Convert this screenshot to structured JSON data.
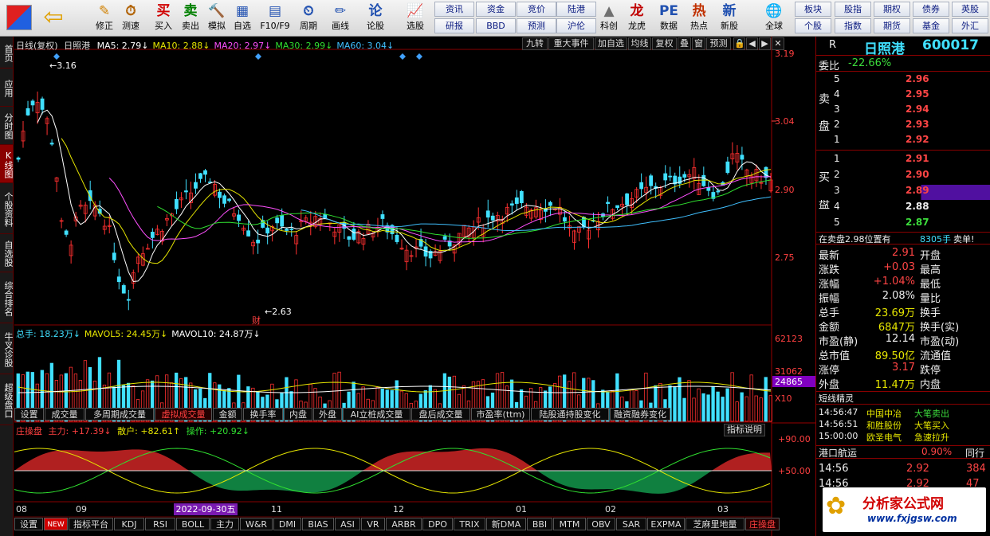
{
  "toolbar": {
    "buttons": [
      "修正",
      "测速",
      "买入",
      "卖出",
      "模拟",
      "自选",
      "F10/F9",
      "周期",
      "画线",
      "论股",
      "选股",
      "科创",
      "龙虎",
      "数据",
      "热点",
      "新股",
      "全球"
    ],
    "grid": [
      "资讯",
      "资金",
      "竞价",
      "陆港",
      "研报",
      "BBD",
      "预测",
      "沪伦",
      "板块",
      "股指",
      "期权",
      "债券",
      "英股",
      "个股",
      "指数",
      "期货",
      "基金",
      "外汇"
    ]
  },
  "leftnav": [
    "首页",
    "应用",
    "分时图",
    "K线图",
    "个股资料",
    "自选股",
    "综合排名",
    "牛叉诊股",
    "超级盘口"
  ],
  "chart": {
    "title": "日线(复权)",
    "stock": "日照港",
    "ma": [
      {
        "label": "MA5: 2.79↓",
        "color": "#ffffff"
      },
      {
        "label": "MA10: 2.88↓",
        "color": "#e6e600"
      },
      {
        "label": "MA20: 2.97↓",
        "color": "#ff50ff"
      },
      {
        "label": "MA30: 2.99↓",
        "color": "#30e030"
      },
      {
        "label": "MA60: 3.04↓",
        "color": "#40c0ff"
      }
    ],
    "buttons": [
      "九转",
      "重大事件",
      "加自选",
      "均线",
      "复权",
      "叠",
      "窗",
      "预测",
      "🔒",
      "◀",
      "▶",
      "✕"
    ],
    "hi": "3.16",
    "lo": "2.63",
    "cai": "财",
    "vol": [
      {
        "label": "总手: 18.23万↓",
        "color": "#40e0ff"
      },
      {
        "label": "MAVOL5: 24.45万↓",
        "color": "#e6e600"
      },
      {
        "label": "MAVOL10: 24.87万↓",
        "color": "#ffffff"
      }
    ],
    "vtabs": [
      "设置",
      "成交量",
      "多周期成交量",
      "虚拟成交量",
      "金额",
      "换手率",
      "内盘",
      "外盘",
      "AI立桩成交量",
      "盘后成交量",
      "市盈率(ttm)",
      "陆股通持股变化",
      "融资融券变化"
    ],
    "ind": {
      "name": "庄操盘",
      "zl": "主力: +17.39↓",
      "sh": "散户: +82.61↑",
      "cz": "操作: +20.92↓",
      "btn": "指标说明"
    },
    "months": [
      "08",
      "09",
      "11",
      "12",
      "01",
      "02",
      "03"
    ],
    "date": "2022-09-30五",
    "btabs": [
      "设置",
      "NEW",
      "指标平台",
      "KDJ",
      "RSI",
      "BOLL",
      "主力",
      "W&R",
      "DMI",
      "BIAS",
      "ASI",
      "VR",
      "ARBR",
      "DPO",
      "TRIX",
      "新DMA",
      "BBI",
      "MTM",
      "OBV",
      "SAR",
      "EXPMA",
      "芝麻里地量",
      "庄操盘"
    ]
  },
  "axis": {
    "price": [
      "3.19",
      "3.04",
      "2.90",
      "2.75"
    ],
    "cur": "2.90",
    "vol": [
      "62123",
      "31062",
      "24865",
      "X10"
    ],
    "ind": [
      "+90.00",
      "+50.00"
    ]
  },
  "rp": {
    "r": "R",
    "name": "日照港",
    "code": "600017",
    "wb": "委比",
    "wbv": "-22.66%",
    "sell": "卖盘",
    "buy": "买盘",
    "sells": [
      [
        "5",
        "2.96"
      ],
      [
        "4",
        "2.95"
      ],
      [
        "3",
        "2.94"
      ],
      [
        "2",
        "2.93"
      ],
      [
        "1",
        "2.92"
      ]
    ],
    "buys": [
      [
        "1",
        "2.91"
      ],
      [
        "2",
        "2.90"
      ],
      [
        "3",
        "2.89"
      ],
      [
        "4",
        "2.88"
      ],
      [
        "5",
        "2.87"
      ]
    ],
    "note": "在卖盘2.98位置有",
    "notev": "8305手",
    "notex": "卖单!",
    "stats": [
      [
        "最新",
        "2.91",
        "开盘"
      ],
      [
        "涨跌",
        "+0.03",
        "最高"
      ],
      [
        "涨幅",
        "+1.04%",
        "最低"
      ],
      [
        "振幅",
        "2.08%",
        "量比"
      ],
      [
        "总手",
        "23.69万",
        "换手"
      ],
      [
        "金额",
        "6847万",
        "换手(实)"
      ],
      [
        "市盈(静)",
        "12.14",
        "市盈(动)"
      ],
      [
        "总市值",
        "89.50亿",
        "流通值"
      ],
      [
        "涨停",
        "3.17",
        "跌停"
      ],
      [
        "外盘",
        "11.47万",
        "内盘"
      ]
    ],
    "dx": "短线精灵",
    "ev": [
      [
        "14:56:47",
        "中国中冶",
        "大笔卖出"
      ],
      [
        "14:56:51",
        "和胜股份",
        "大笔买入"
      ],
      [
        "15:00:00",
        "欧圣电气",
        "急速拉升"
      ]
    ],
    "gk": "港口航运",
    "gkv": "0.90%",
    "gkt": "同行",
    "tk": [
      [
        "14:56",
        "2.92",
        "384"
      ],
      [
        "14:56",
        "2.92",
        "47"
      ]
    ],
    "logo": "分析家公式网",
    "url": "www.fxjgsw.com"
  }
}
